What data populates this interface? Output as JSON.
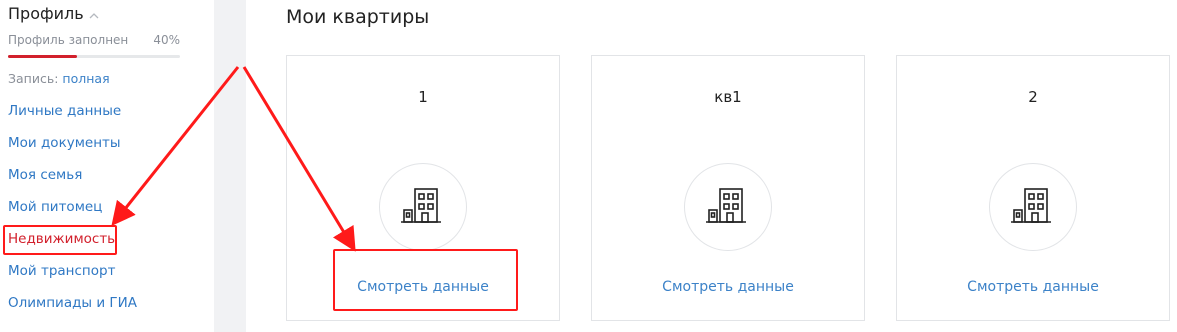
{
  "sidebar": {
    "profile_title": "Профиль",
    "progress_label": "Профиль заполнен",
    "progress_value": "40%",
    "progress_fraction": 0.4,
    "record_label": "Запись:",
    "record_value": "полная",
    "items": [
      {
        "label": "Личные данные",
        "active": false
      },
      {
        "label": "Мои документы",
        "active": false
      },
      {
        "label": "Моя семья",
        "active": false
      },
      {
        "label": "Мой питомец",
        "active": false
      },
      {
        "label": "Недвижимость",
        "active": true
      },
      {
        "label": "Мой транспорт",
        "active": false
      },
      {
        "label": "Олимпиады и ГИА",
        "active": false
      }
    ]
  },
  "main": {
    "title": "Мои квартиры",
    "cards": [
      {
        "name": "1",
        "link": "Смотреть данные"
      },
      {
        "name": "кв1",
        "link": "Смотреть данные"
      },
      {
        "name": "2",
        "link": "Смотреть данные"
      }
    ]
  },
  "colors": {
    "accent_red": "#d2202c",
    "link_blue": "#3c82c8",
    "annotation_red": "#ff1a1a"
  },
  "icons": [
    "chevron-up-icon",
    "building-icon",
    "arrow-icon"
  ]
}
